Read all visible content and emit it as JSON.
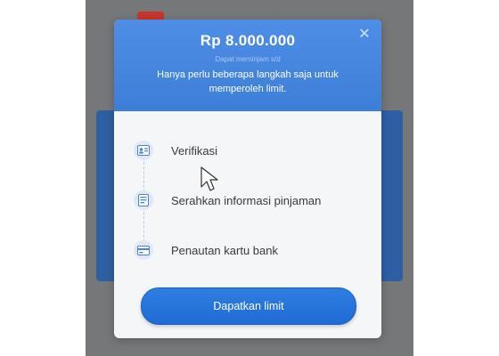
{
  "dialog": {
    "amount": "Rp 8.000.000",
    "sublabel": "Dapat meminjam s/d",
    "description": "Hanya perlu beberapa langkah saja untuk memperoleh limit.",
    "close_icon": "close-icon"
  },
  "steps": [
    {
      "label": "Verifikasi",
      "icon": "id-card-icon"
    },
    {
      "label": "Serahkan informasi pinjaman",
      "icon": "document-icon"
    },
    {
      "label": "Penautan kartu bank",
      "icon": "bank-card-icon"
    }
  ],
  "cta": {
    "label": "Dapatkan limit"
  },
  "colors": {
    "header": "#4f8ee6",
    "button": "#2a78df",
    "overlay": "#757779",
    "icon_bg": "#dfe8f6"
  }
}
